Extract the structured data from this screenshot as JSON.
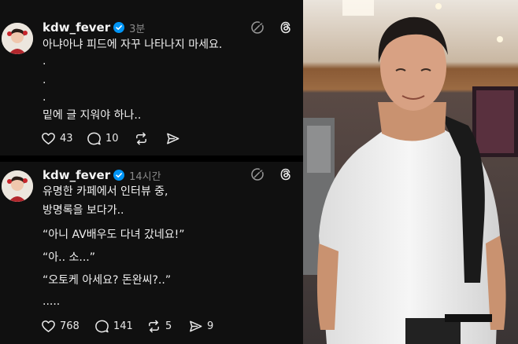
{
  "posts": [
    {
      "username": "kdw_fever",
      "time": "3분",
      "lines": [
        "아냐아냐 피드에 자꾸 나타나지 마세요.",
        ".",
        ".",
        ".",
        "밑에 글 지워야 하나.."
      ],
      "likes": "43",
      "comments": "10",
      "reposts": "",
      "shares": ""
    },
    {
      "username": "kdw_fever",
      "time": "14시간",
      "lines": [
        "유명한 카페에서 인터뷰 중,",
        "방명록을 보다가..",
        "“아니 AV배우도 다녀 갔네요!”",
        "“아.. 소...”",
        "“오토케 아세요? 돈완씨?..”",
        "....."
      ],
      "likes": "768",
      "comments": "141",
      "reposts": "5",
      "shares": "9"
    }
  ],
  "icons": {
    "verified": "verified-badge-icon",
    "hide": "slash-circle-icon",
    "app": "threads-logo-icon",
    "like": "heart-icon",
    "comment": "comment-bubble-icon",
    "repost": "repost-icon",
    "share": "send-icon"
  },
  "colors": {
    "background": "#101010",
    "verified": "#0095f6",
    "muted": "#8a8a8a"
  }
}
